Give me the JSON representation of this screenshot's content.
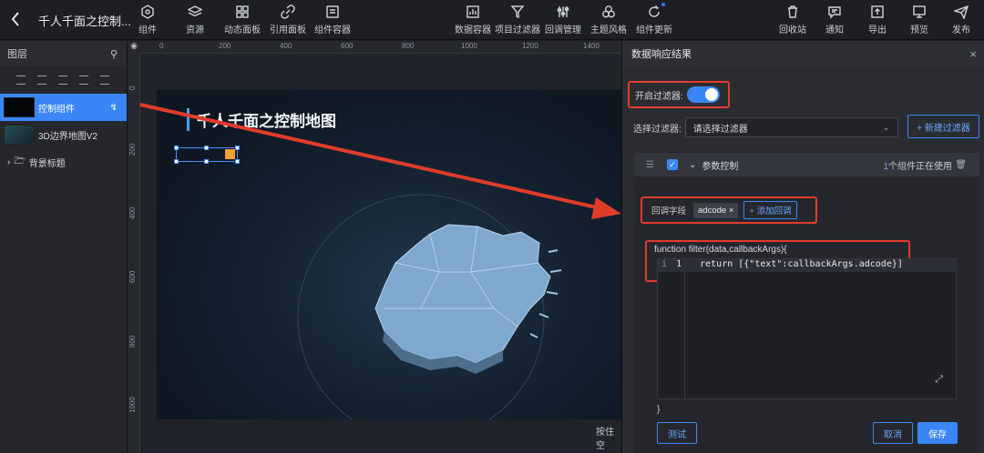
{
  "header": {
    "title": "千人千面之控制...",
    "tools_left": [
      {
        "label": "组件",
        "icon": "component-icon"
      },
      {
        "label": "资源",
        "icon": "layers-icon"
      },
      {
        "label": "动态面板",
        "icon": "dynamic-panel-icon"
      },
      {
        "label": "引用面板",
        "icon": "link-icon"
      },
      {
        "label": "组件容器",
        "icon": "container-icon"
      }
    ],
    "tools_mid": [
      {
        "label": "数据容器",
        "icon": "chart-icon"
      },
      {
        "label": "项目过滤器",
        "icon": "filter-icon"
      },
      {
        "label": "回调管理",
        "icon": "sliders-icon"
      },
      {
        "label": "主题风格",
        "icon": "palette-icon"
      },
      {
        "label": "组件更新",
        "icon": "refresh-icon"
      }
    ],
    "tools_right": [
      {
        "label": "回收站",
        "icon": "trash-icon"
      },
      {
        "label": "通知",
        "icon": "message-icon"
      },
      {
        "label": "导出",
        "icon": "export-icon"
      },
      {
        "label": "预览",
        "icon": "preview-icon"
      },
      {
        "label": "发布",
        "icon": "send-icon"
      }
    ]
  },
  "layers": {
    "title": "图层",
    "items": [
      {
        "label": "控制组件",
        "active": true
      },
      {
        "label": "3D边界地图V2",
        "active": false
      },
      {
        "label": "背景标题",
        "active": false
      }
    ]
  },
  "canvas": {
    "ruler_top": [
      "0",
      "200",
      "400",
      "600",
      "800",
      "1000",
      "1200",
      "1400"
    ],
    "ruler_left": [
      "0",
      "200",
      "400",
      "600",
      "800",
      "1000"
    ],
    "stage_title": "千人千面之控制地图",
    "hint": "按住空"
  },
  "panel": {
    "title": "数据响应结果",
    "toggle_label": "开启过滤器:",
    "toggle_on": true,
    "filter_label": "选择过滤器:",
    "filter_placeholder": "请选择过滤器",
    "new_filter": "+ 新建过滤器",
    "card": {
      "title": "参数控制",
      "using_count": "1",
      "using_text": "个组件正在使用",
      "callback_label": "回调字段",
      "callback_tag": "adcode",
      "add_callback": "+ 添加回调",
      "function_sig": "function filter(data,callbackArgs){",
      "line_no": "1",
      "code": "return [{\"text\":callbackArgs.adcode}]",
      "close_brace": "}",
      "test": "测试",
      "cancel": "取消",
      "save": "保存"
    }
  },
  "colors": {
    "accent": "#3b86f7",
    "highlight": "#e03c2b",
    "bg": "#1b1d22"
  }
}
